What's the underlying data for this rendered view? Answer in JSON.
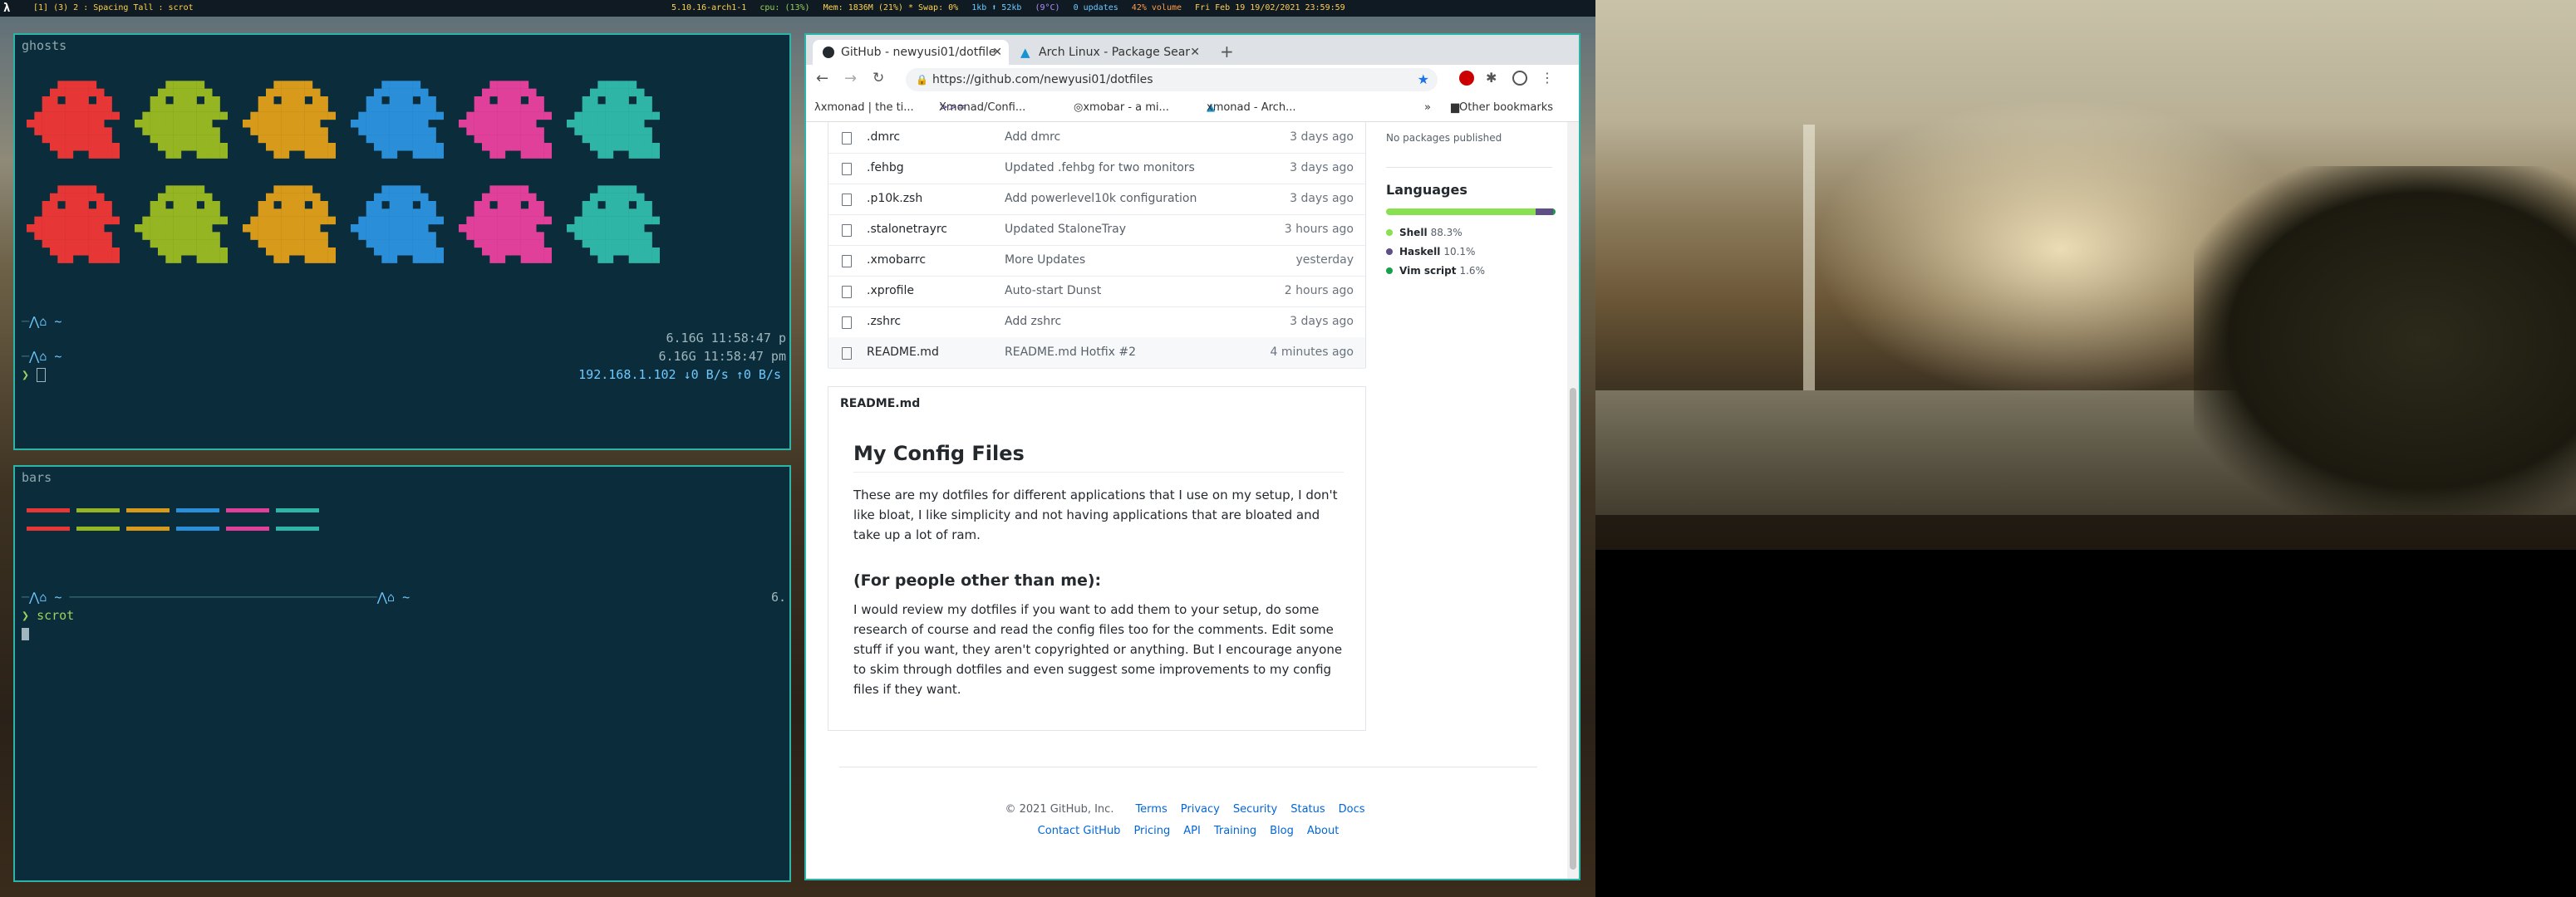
{
  "topbar": {
    "workspace_text": "[1] (3) 2 : Spacing Tall : scrot",
    "kernel": "5.10.16-arch1-1",
    "cpu": "cpu: (13%)",
    "mem": "Mem: 1836M (21%) * Swap: 0%",
    "net": "1kb ⬆ 52kb",
    "temp": "(9°C)",
    "updates": "0 updates",
    "volume": "42% volume",
    "datetime": "Fri Feb 19 19/02/2021 23:59:59"
  },
  "term1": {
    "title": "ghosts",
    "ghost_colors": [
      "#e63636",
      "#95b522",
      "#d79a1a",
      "#2a8fd8",
      "#e0409a",
      "#2fb5a6"
    ],
    "line1_right": "6.16G  11:58:47 p",
    "line2_right": "6.16G  11:58:47 pm",
    "net_line": "192.168.1.102 ↓0 B/s ↑0 B/s",
    "prompt_char": "❯"
  },
  "term2": {
    "title": "bars",
    "bar_colors": [
      "#e63636",
      "#95b522",
      "#d79a1a",
      "#2a8fd8",
      "#e0409a",
      "#2fb5a6"
    ],
    "right_text": "6.",
    "command": "scrot"
  },
  "chrome": {
    "tabs": [
      {
        "label": "GitHub - newyusi01/dotfile"
      },
      {
        "label": "Arch Linux - Package Sear"
      }
    ],
    "new_tab": "+",
    "url": "https://github.com/newyusi01/dotfiles",
    "bookmarks": [
      "xmonad | the ti...",
      "Xmonad/Confi...",
      "xmobar - a mi...",
      "xmonad - Arch..."
    ],
    "bookmarks_more": "»",
    "other_bookmarks": "Other bookmarks",
    "files": [
      {
        "name": ".dmrc",
        "msg": "Add dmrc",
        "time": "3 days ago"
      },
      {
        "name": ".fehbg",
        "msg": "Updated .fehbg for two monitors",
        "time": "3 days ago"
      },
      {
        "name": ".p10k.zsh",
        "msg": "Add powerlevel10k configuration",
        "time": "3 days ago"
      },
      {
        "name": ".stalonetrayrc",
        "msg": "Updated StaloneTray",
        "time": "3 hours ago"
      },
      {
        "name": ".xmobarrc",
        "msg": "More Updates",
        "time": "yesterday"
      },
      {
        "name": ".xprofile",
        "msg": "Auto-start Dunst",
        "time": "2 hours ago"
      },
      {
        "name": ".zshrc",
        "msg": "Add zshrc",
        "time": "3 days ago"
      },
      {
        "name": "README.md",
        "msg": "README.md Hotfix #2",
        "time": "4 minutes ago"
      }
    ],
    "readme": {
      "filename": "README.md",
      "h1": "My Config Files",
      "p1": "These are my dotfiles for different applications that I use on my setup, I don't like bloat, I like simplicity and not having applications that are bloated and take up a lot of ram.",
      "h2": "(For people other than me):",
      "p2": "I would review my dotfiles if you want to add them to your setup, do some research of course and read the config files too for the comments. Edit some stuff if you want, they aren't copyrighted or anything. But I encourage anyone to skim through dotfiles and even suggest some improvements to my config files if they want."
    },
    "sidebar": {
      "packages": "No packages published",
      "languages_title": "Languages",
      "languages": [
        {
          "name": "Shell",
          "pct": "88.3%",
          "value": 88.3,
          "color": "#89e051"
        },
        {
          "name": "Haskell",
          "pct": "10.1%",
          "value": 10.1,
          "color": "#5e5086"
        },
        {
          "name": "Vim script",
          "pct": "1.6%",
          "value": 1.6,
          "color": "#199f4b"
        }
      ]
    },
    "footer": {
      "copyright": "© 2021 GitHub, Inc.",
      "links1": [
        "Terms",
        "Privacy",
        "Security",
        "Status",
        "Docs"
      ],
      "links2": [
        "Contact GitHub",
        "Pricing",
        "API",
        "Training",
        "Blog",
        "About"
      ]
    }
  }
}
